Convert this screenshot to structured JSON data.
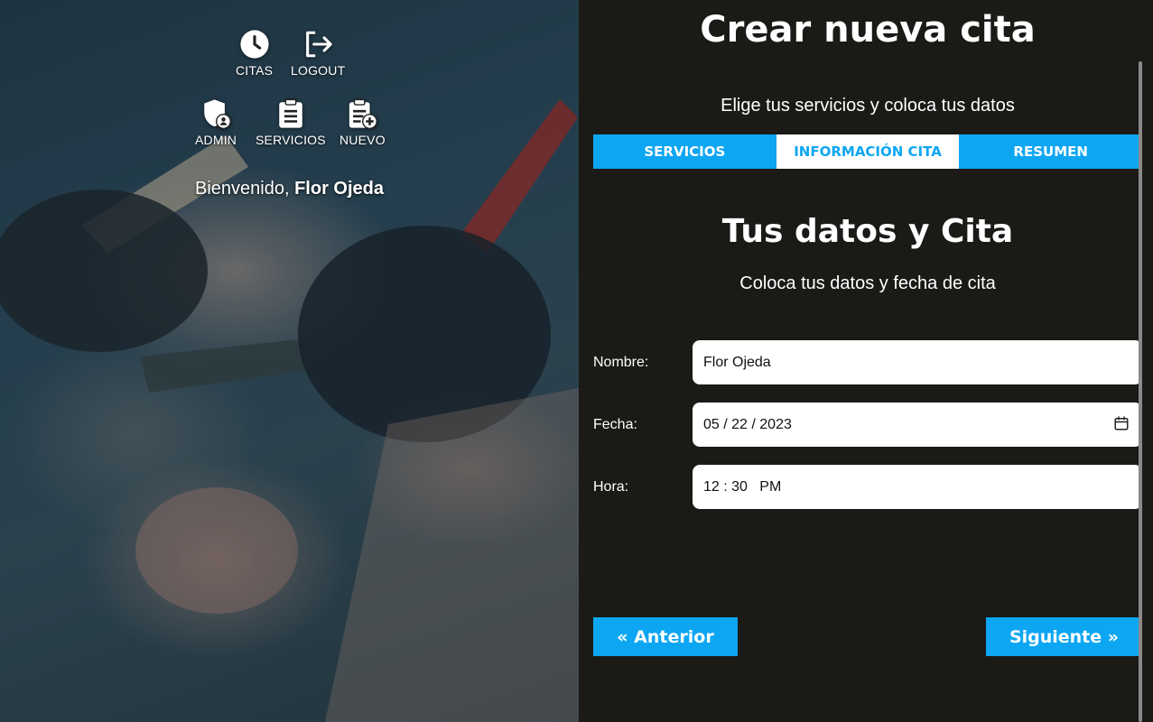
{
  "nav": {
    "items": [
      {
        "label": "CITAS",
        "icon": "clock-icon"
      },
      {
        "label": "LOGOUT",
        "icon": "logout-icon"
      },
      {
        "label": "ADMIN",
        "icon": "shield-user-icon"
      },
      {
        "label": "SERVICIOS",
        "icon": "clipboard-list-icon"
      },
      {
        "label": "NUEVO",
        "icon": "clipboard-add-icon"
      }
    ]
  },
  "welcome": {
    "prefix": "Bienvenido,",
    "name": "Flor Ojeda"
  },
  "page": {
    "title": "Crear nueva cita",
    "subtitle": "Elige tus servicios y coloca tus datos"
  },
  "tabs": [
    {
      "label": "SERVICIOS",
      "active": false
    },
    {
      "label": "INFORMACIÓN CITA",
      "active": true
    },
    {
      "label": "RESUMEN",
      "active": false
    }
  ],
  "section": {
    "title": "Tus datos y Cita",
    "subtitle": "Coloca tus datos y fecha de cita"
  },
  "form": {
    "nombre": {
      "label": "Nombre:",
      "value": "Flor Ojeda"
    },
    "fecha": {
      "label": "Fecha:",
      "value": "05 / 22 / 2023"
    },
    "hora": {
      "label": "Hora:",
      "value": "12 : 30   PM"
    }
  },
  "buttons": {
    "prev": "« Anterior",
    "next": "Siguiente »"
  },
  "colors": {
    "accent": "#0da6f2",
    "panel_bg": "#1b1a17",
    "text": "#ffffff"
  }
}
